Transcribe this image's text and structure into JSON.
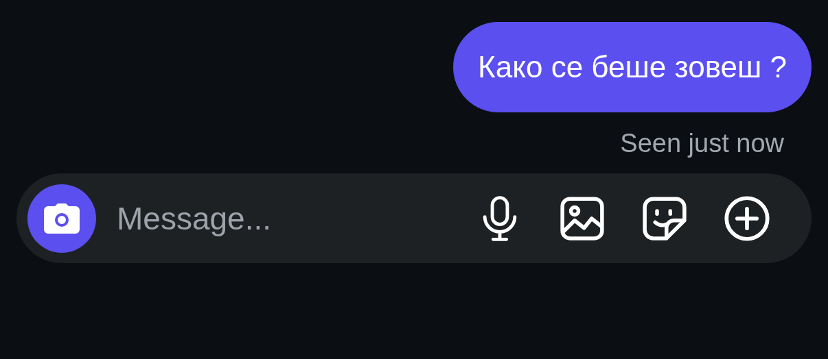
{
  "messages": [
    {
      "text": "Како се беше зовеш ?"
    }
  ],
  "status": "Seen just now",
  "composer": {
    "placeholder": "Message..."
  }
}
